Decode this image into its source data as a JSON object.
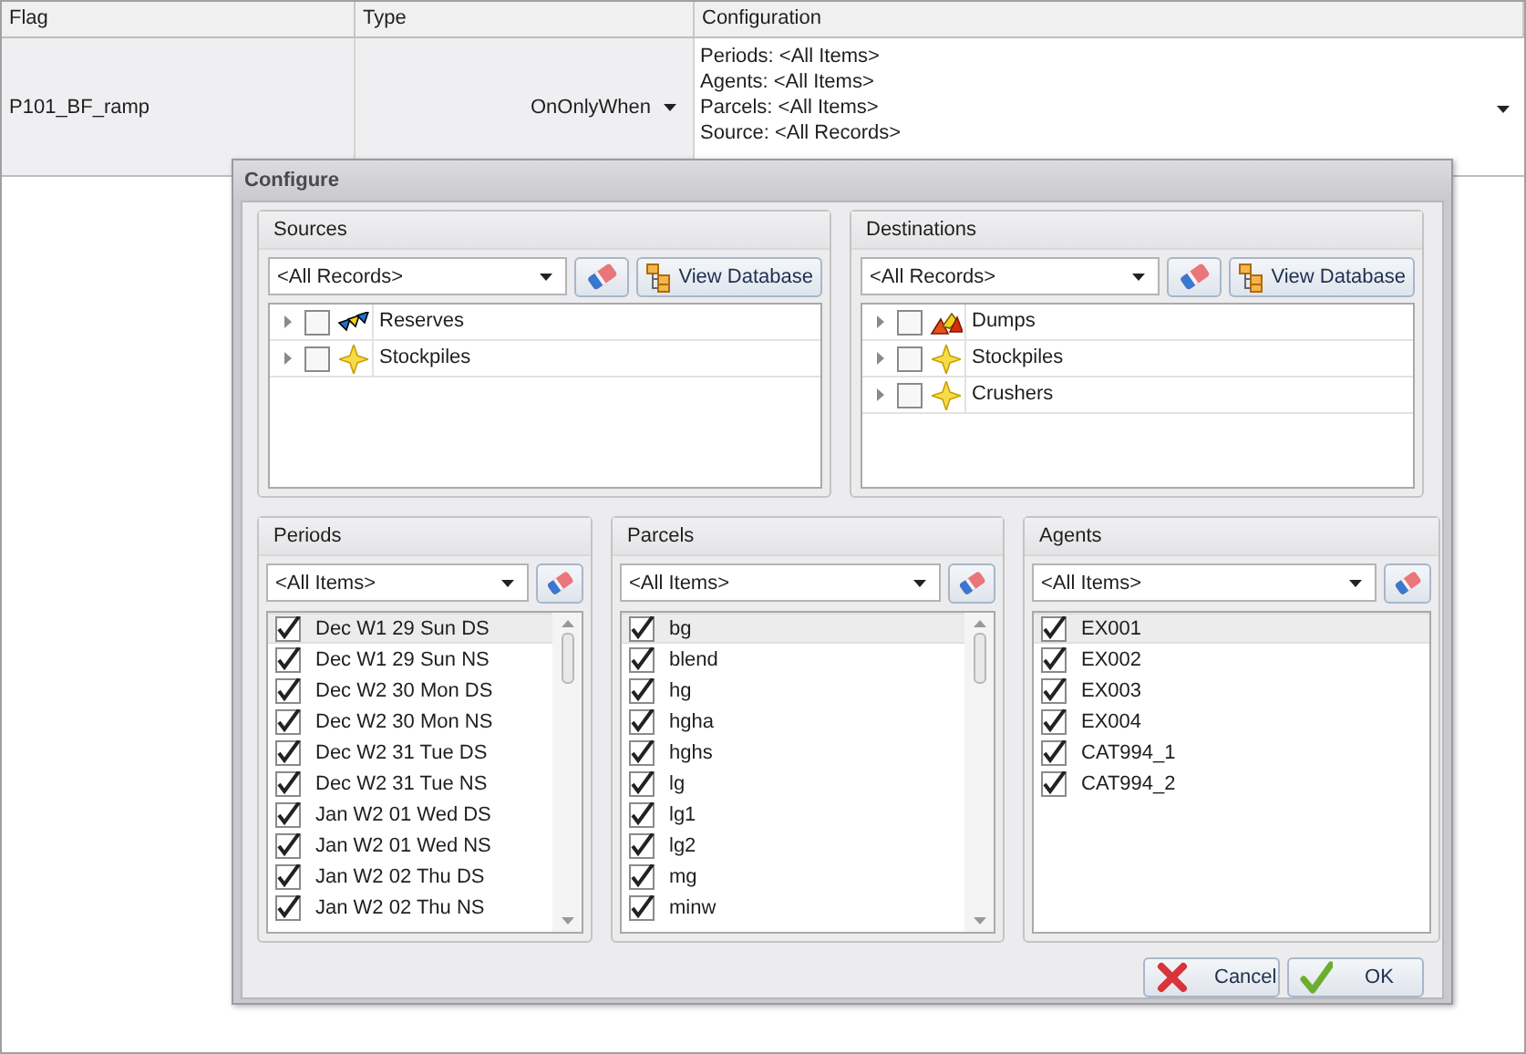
{
  "grid": {
    "columns": [
      "Flag",
      "Type",
      "Configuration"
    ],
    "row": {
      "flag": "P101_BF_ramp",
      "type": "OnOnlyWhen",
      "configuration": [
        "Periods: <All Items>",
        "Agents: <All Items>",
        "Parcels: <All Items>",
        "Source: <All Records>"
      ]
    }
  },
  "dialog": {
    "title": "Configure",
    "sources": {
      "title": "Sources",
      "filter": "<All Records>",
      "view_button": "View Database",
      "items": [
        {
          "label": "Reserves",
          "kind": "reserves",
          "checked": false
        },
        {
          "label": "Stockpiles",
          "kind": "star",
          "checked": false
        }
      ]
    },
    "destinations": {
      "title": "Destinations",
      "filter": "<All Records>",
      "view_button": "View Database",
      "items": [
        {
          "label": "Dumps",
          "kind": "dumps",
          "checked": false
        },
        {
          "label": "Stockpiles",
          "kind": "star",
          "checked": false
        },
        {
          "label": "Crushers",
          "kind": "star",
          "checked": false
        }
      ]
    },
    "lists": [
      {
        "title": "Periods",
        "filter": "<All Items>",
        "scrollbar": true,
        "items": [
          {
            "label": "Dec W1 29 Sun DS",
            "checked": true,
            "selected": true
          },
          {
            "label": "Dec W1 29 Sun NS",
            "checked": true,
            "selected": false
          },
          {
            "label": "Dec W2 30 Mon DS",
            "checked": true,
            "selected": false
          },
          {
            "label": "Dec W2 30 Mon NS",
            "checked": true,
            "selected": false
          },
          {
            "label": "Dec W2 31 Tue DS",
            "checked": true,
            "selected": false
          },
          {
            "label": "Dec W2 31 Tue NS",
            "checked": true,
            "selected": false
          },
          {
            "label": "Jan W2 01 Wed DS",
            "checked": true,
            "selected": false
          },
          {
            "label": "Jan W2 01 Wed NS",
            "checked": true,
            "selected": false
          },
          {
            "label": "Jan W2 02 Thu DS",
            "checked": true,
            "selected": false
          },
          {
            "label": "Jan W2 02 Thu NS",
            "checked": true,
            "selected": false
          }
        ]
      },
      {
        "title": "Parcels",
        "filter": "<All Items>",
        "scrollbar": true,
        "items": [
          {
            "label": "bg",
            "checked": true,
            "selected": true
          },
          {
            "label": "blend",
            "checked": true,
            "selected": false
          },
          {
            "label": "hg",
            "checked": true,
            "selected": false
          },
          {
            "label": "hgha",
            "checked": true,
            "selected": false
          },
          {
            "label": "hghs",
            "checked": true,
            "selected": false
          },
          {
            "label": "lg",
            "checked": true,
            "selected": false
          },
          {
            "label": "lg1",
            "checked": true,
            "selected": false
          },
          {
            "label": "lg2",
            "checked": true,
            "selected": false
          },
          {
            "label": "mg",
            "checked": true,
            "selected": false
          },
          {
            "label": "minw",
            "checked": true,
            "selected": false
          }
        ]
      },
      {
        "title": "Agents",
        "filter": "<All Items>",
        "scrollbar": false,
        "items": [
          {
            "label": "EX001",
            "checked": true,
            "selected": true
          },
          {
            "label": "EX002",
            "checked": true,
            "selected": false
          },
          {
            "label": "EX003",
            "checked": true,
            "selected": false
          },
          {
            "label": "EX004",
            "checked": true,
            "selected": false
          },
          {
            "label": "CAT994_1",
            "checked": true,
            "selected": false
          },
          {
            "label": "CAT994_2",
            "checked": true,
            "selected": false
          }
        ]
      }
    ],
    "buttons": [
      {
        "label": "Cancel",
        "kind": "cancel"
      },
      {
        "label": "OK",
        "kind": "ok"
      }
    ]
  }
}
